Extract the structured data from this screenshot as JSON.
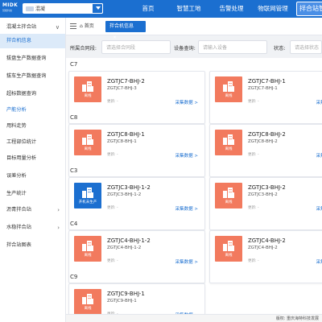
{
  "header": {
    "logo_text": "MIDK",
    "logo_sub": "慧能科技",
    "org_select": "混凝",
    "nav": [
      "首页",
      "智慧工地",
      "告警处理",
      "物联网管理",
      "拌合站管"
    ],
    "active_nav_index": 4
  },
  "sidebar": {
    "items": [
      {
        "label": "混凝土拌合站",
        "chevron": "∨"
      },
      {
        "label": "拌合机信息",
        "chevron": ""
      },
      {
        "label": "拔盘生产数据查询",
        "chevron": ""
      },
      {
        "label": "拔车生产数据查询",
        "chevron": ""
      },
      {
        "label": "超标数据查询",
        "chevron": ""
      },
      {
        "label": "产能分析",
        "chevron": ""
      },
      {
        "label": "用料走势",
        "chevron": ""
      },
      {
        "label": "工程部位统计",
        "chevron": ""
      },
      {
        "label": "目标用量分析",
        "chevron": ""
      },
      {
        "label": "误差分析",
        "chevron": ""
      },
      {
        "label": "生产统计",
        "chevron": ""
      },
      {
        "label": "沥青拌合站",
        "chevron": "›"
      },
      {
        "label": "水稳拌合站",
        "chevron": "›"
      },
      {
        "label": "拌合站图表",
        "chevron": ""
      }
    ]
  },
  "tabs": {
    "home_label": "首页",
    "current_label": "拌合机信息",
    "close_glyph": "×"
  },
  "filters": {
    "project_label": "所属合同段:",
    "project_placeholder": "请选择合同段",
    "device_label": "设备查询:",
    "device_placeholder": "请输入设备",
    "status_label": "状态:",
    "status_placeholder": "请选择状态"
  },
  "groups": [
    {
      "title": "C7",
      "cards": [
        {
          "name": "ZGTJC7-BHJ-2",
          "code": "ZGTJC7-BHJ-3",
          "state": "离线",
          "status": "off",
          "update": "更新: -",
          "link": "采集数据 >"
        },
        {
          "name": "ZGTJC7-BHJ-1",
          "code": "ZGTJC7-BHJ-1",
          "state": "离线",
          "status": "off",
          "update": "更新: -",
          "link": "采集数据 >"
        }
      ]
    },
    {
      "title": "C8",
      "cards": [
        {
          "name": "ZGTJC8-BHJ-1",
          "code": "ZGTJC8-BHJ-1",
          "state": "离线",
          "status": "off",
          "update": "更新: -",
          "link": "采集数据 >"
        },
        {
          "name": "ZGTJC8-BHJ-2",
          "code": "ZGTJC8-BHJ-2",
          "state": "离线",
          "status": "off",
          "update": "更新: -",
          "link": "采集数据 >"
        }
      ]
    },
    {
      "title": "C3",
      "cards": [
        {
          "name": "ZGTJC3-BHJ-1-2",
          "code": "ZGTJC3-BHJ-1-2",
          "state": "开机未生产",
          "status": "on",
          "update": "更新: -",
          "link": "采集数据 >"
        },
        {
          "name": "ZGTJC3-BHJ-2",
          "code": "ZGTJC3-BHJ-2",
          "state": "离线",
          "status": "off",
          "update": "更新: -",
          "link": "采集数据 >"
        }
      ]
    },
    {
      "title": "C4",
      "cards": [
        {
          "name": "ZGTJC4-BHJ-1-2",
          "code": "ZGTJC4-BHJ-1-2",
          "state": "离线",
          "status": "off",
          "update": "更新: -",
          "link": "采集数据 >"
        },
        {
          "name": "ZGTJC4-BHJ-2",
          "code": "ZGTJC4-BHJ-2",
          "state": "离线",
          "status": "off",
          "update": "更新: -",
          "link": "采集数据 >"
        }
      ]
    },
    {
      "title": "C9",
      "cards": [
        {
          "name": "ZGTJC9-BHJ-1",
          "code": "ZGTJC9-BHJ-1",
          "state": "离线",
          "status": "off",
          "update": "更新: -",
          "link": "采集数据 >"
        }
      ]
    }
  ],
  "footer": {
    "text": "版权: 重庆海特科技发展"
  },
  "colors": {
    "primary": "#1b6fd0",
    "offline": "#f27a5e",
    "online": "#1b6fd0"
  }
}
